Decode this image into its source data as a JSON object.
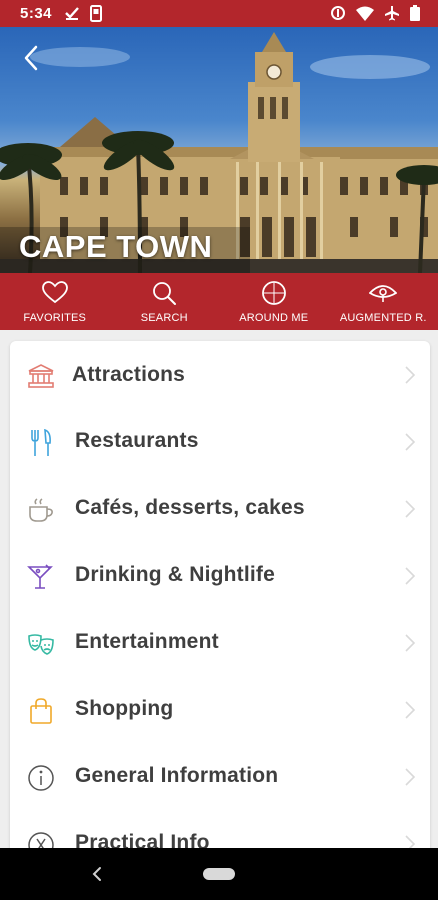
{
  "status_bar": {
    "time": "5:34",
    "left_icons": [
      "download-done-icon",
      "phone-icon"
    ],
    "right_icons": [
      "data-saver-icon",
      "wifi-icon",
      "airplane-icon",
      "battery-icon"
    ]
  },
  "hero": {
    "city_name": "CAPE TOWN",
    "back_icon": "chevron-left-icon"
  },
  "tabs": [
    {
      "label": "FAVORITES",
      "icon": "heart-icon"
    },
    {
      "label": "SEARCH",
      "icon": "search-icon"
    },
    {
      "label": "AROUND ME",
      "icon": "compass-icon"
    },
    {
      "label": "AUGMENTED R.",
      "icon": "eye-icon"
    }
  ],
  "categories": [
    {
      "label": "Attractions",
      "icon": "landmark-icon",
      "color": "#e27d73"
    },
    {
      "label": "Restaurants",
      "icon": "fork-knife-icon",
      "color": "#3fa4dc"
    },
    {
      "label": "Cafés, desserts, cakes",
      "icon": "coffee-cup-icon",
      "color": "#a09a90"
    },
    {
      "label": "Drinking & Nightlife",
      "icon": "cocktail-icon",
      "color": "#7a4ec0"
    },
    {
      "label": "Entertainment",
      "icon": "theater-masks-icon",
      "color": "#36b9a3"
    },
    {
      "label": "Shopping",
      "icon": "shopping-bag-icon",
      "color": "#f0a92a"
    },
    {
      "label": "General Information",
      "icon": "info-icon",
      "color": "#555555"
    },
    {
      "label": "Practical Info",
      "icon": "practical-info-icon",
      "color": "#555555"
    }
  ],
  "colors": {
    "brand": "#b3262c",
    "text": "#3f3f3f",
    "chevron": "#d9d9d9"
  }
}
